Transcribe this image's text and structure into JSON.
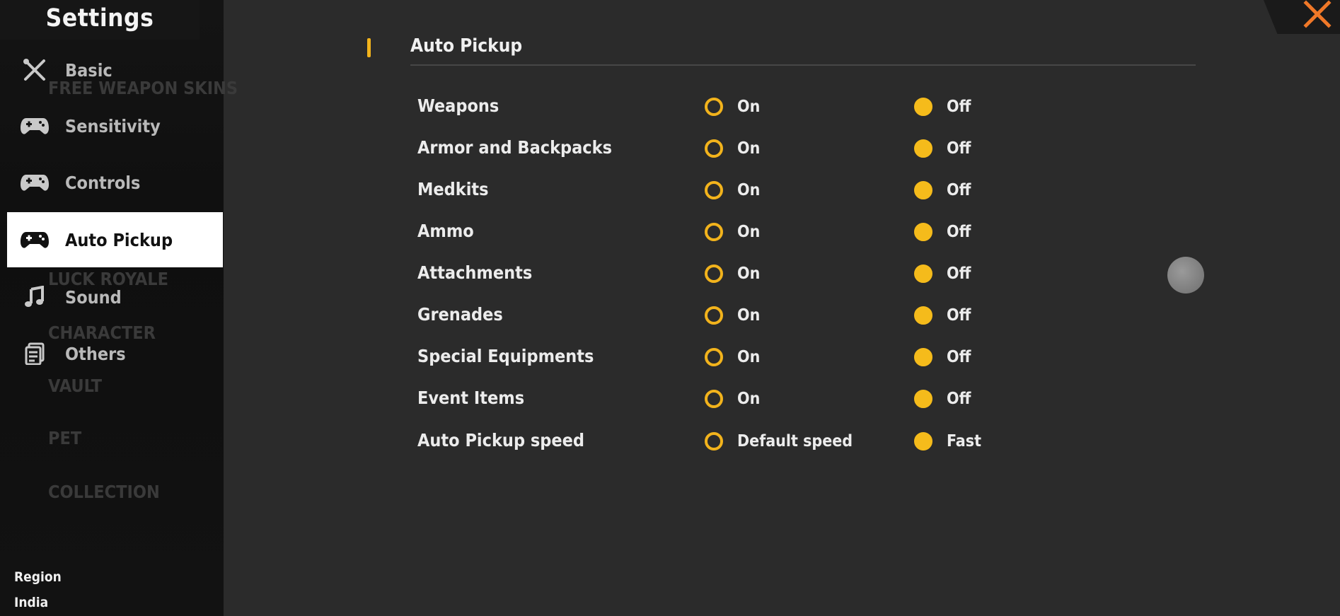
{
  "colors": {
    "accent": "#f2b31c",
    "background": "#2b2b2b",
    "sidebar": "#121212",
    "active_nav": "#ffffff"
  },
  "sidebar": {
    "title": "Settings",
    "items": [
      {
        "label": "Basic",
        "icon": "wrench-screwdriver-icon",
        "active": false
      },
      {
        "label": "Sensitivity",
        "icon": "gamepad-icon",
        "active": false
      },
      {
        "label": "Controls",
        "icon": "gamepad-icon",
        "active": false
      },
      {
        "label": "Auto Pickup",
        "icon": "gamepad-icon",
        "active": true
      },
      {
        "label": "Sound",
        "icon": "music-note-icon",
        "active": false
      },
      {
        "label": "Others",
        "icon": "document-icon",
        "active": false
      }
    ],
    "background_text": [
      "FREE WEAPON SKINS",
      "LUCK ROYALE",
      "CHARACTER",
      "VAULT",
      "PET",
      "COLLECTION"
    ],
    "region_label": "Region",
    "region_value": "India"
  },
  "main": {
    "section_title": "Auto Pickup",
    "rows": [
      {
        "label": "Weapons",
        "option_a": "On",
        "option_b": "Off",
        "selected": "b"
      },
      {
        "label": "Armor and Backpacks",
        "option_a": "On",
        "option_b": "Off",
        "selected": "b"
      },
      {
        "label": "Medkits",
        "option_a": "On",
        "option_b": "Off",
        "selected": "b"
      },
      {
        "label": "Ammo",
        "option_a": "On",
        "option_b": "Off",
        "selected": "b"
      },
      {
        "label": "Attachments",
        "option_a": "On",
        "option_b": "Off",
        "selected": "b"
      },
      {
        "label": "Grenades",
        "option_a": "On",
        "option_b": "Off",
        "selected": "b"
      },
      {
        "label": "Special Equipments",
        "option_a": "On",
        "option_b": "Off",
        "selected": "b"
      },
      {
        "label": "Event Items",
        "option_a": "On",
        "option_b": "Off",
        "selected": "b"
      },
      {
        "label": "Auto Pickup speed",
        "option_a": "Default speed",
        "option_b": "Fast",
        "selected": "b"
      }
    ]
  }
}
